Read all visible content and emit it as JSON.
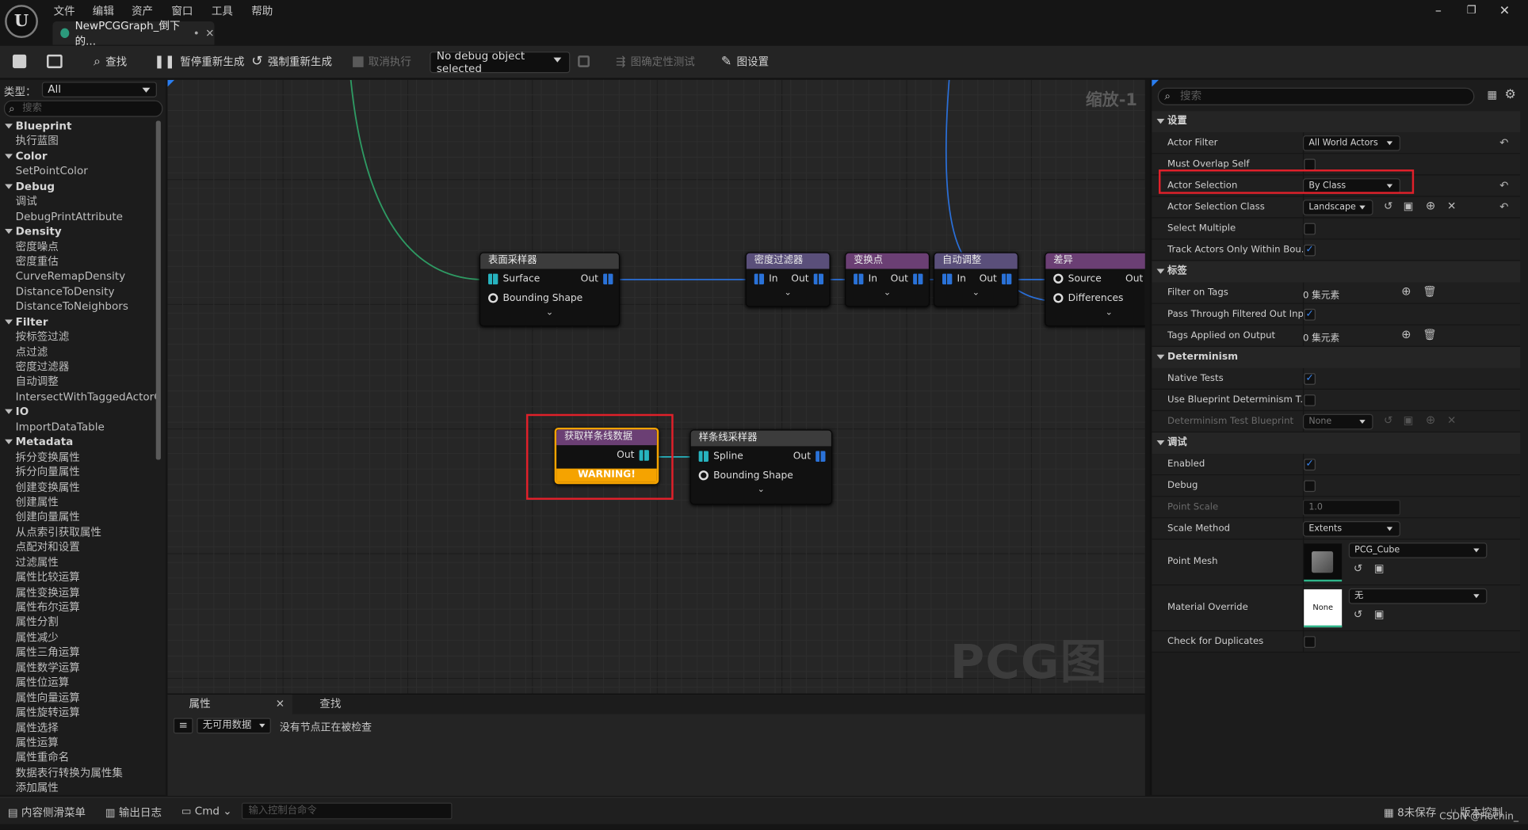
{
  "menu": [
    "文件",
    "编辑",
    "资产",
    "窗口",
    "工具",
    "帮助"
  ],
  "tab": {
    "title": "NewPCGGraph_倒下的..."
  },
  "toolbar": {
    "find": "查找",
    "pause": "暂停重新生成",
    "force": "强制重新生成",
    "cancel": "取消执行",
    "debug": "No debug object selected",
    "determinism": "图确定性测试",
    "settings": "图设置"
  },
  "palette": {
    "type_label": "类型：",
    "type_value": "All",
    "search_placeholder": "搜索",
    "items": [
      {
        "k": "cat",
        "t": "Blueprint"
      },
      {
        "k": "it",
        "t": "执行蓝图"
      },
      {
        "k": "cat",
        "t": "Color"
      },
      {
        "k": "it",
        "t": "SetPointColor"
      },
      {
        "k": "cat",
        "t": "Debug"
      },
      {
        "k": "it",
        "t": "调试"
      },
      {
        "k": "it",
        "t": "DebugPrintAttribute"
      },
      {
        "k": "cat",
        "t": "Density"
      },
      {
        "k": "it",
        "t": "密度噪点"
      },
      {
        "k": "it",
        "t": "密度重估"
      },
      {
        "k": "it",
        "t": "CurveRemapDensity"
      },
      {
        "k": "it",
        "t": "DistanceToDensity"
      },
      {
        "k": "it",
        "t": "DistanceToNeighbors"
      },
      {
        "k": "cat",
        "t": "Filter"
      },
      {
        "k": "it",
        "t": "按标签过滤"
      },
      {
        "k": "it",
        "t": "点过滤"
      },
      {
        "k": "it",
        "t": "密度过滤器"
      },
      {
        "k": "it",
        "t": "自动调整"
      },
      {
        "k": "it",
        "t": "IntersectWithTaggedActorGec"
      },
      {
        "k": "cat",
        "t": "IO"
      },
      {
        "k": "it",
        "t": "ImportDataTable"
      },
      {
        "k": "cat",
        "t": "Metadata"
      },
      {
        "k": "it",
        "t": "拆分变换属性"
      },
      {
        "k": "it",
        "t": "拆分向量属性"
      },
      {
        "k": "it",
        "t": "创建变换属性"
      },
      {
        "k": "it",
        "t": "创建属性"
      },
      {
        "k": "it",
        "t": "创建向量属性"
      },
      {
        "k": "it",
        "t": "从点索引获取属性"
      },
      {
        "k": "it",
        "t": "点配对和设置"
      },
      {
        "k": "it",
        "t": "过滤属性"
      },
      {
        "k": "it",
        "t": "属性比较运算"
      },
      {
        "k": "it",
        "t": "属性变换运算"
      },
      {
        "k": "it",
        "t": "属性布尔运算"
      },
      {
        "k": "it",
        "t": "属性分割"
      },
      {
        "k": "it",
        "t": "属性减少"
      },
      {
        "k": "it",
        "t": "属性三角运算"
      },
      {
        "k": "it",
        "t": "属性数学运算"
      },
      {
        "k": "it",
        "t": "属性位运算"
      },
      {
        "k": "it",
        "t": "属性向量运算"
      },
      {
        "k": "it",
        "t": "属性旋转运算"
      },
      {
        "k": "it",
        "t": "属性选择"
      },
      {
        "k": "it",
        "t": "属性运算"
      },
      {
        "k": "it",
        "t": "属性重命名"
      },
      {
        "k": "it",
        "t": "数据表行转换为属性集"
      },
      {
        "k": "it",
        "t": "添加属性"
      }
    ]
  },
  "graph": {
    "zoom": "缩放-1",
    "watermark": "PCG图表",
    "nodes": {
      "surface": {
        "title": "表面采样器",
        "pin1": "Surface",
        "pin2": "Bounding Shape",
        "out": "Out"
      },
      "density": {
        "title": "密度过滤器",
        "in": "In",
        "out": "Out"
      },
      "transform": {
        "title": "变换点",
        "in": "In",
        "out": "Out"
      },
      "auto": {
        "title": "自动调整",
        "in": "In",
        "out": "Out"
      },
      "diff": {
        "title": "差异",
        "pin1": "Source",
        "pin2": "Differences",
        "out": "Out"
      },
      "getspline": {
        "title": "获取样条线数据",
        "out": "Out",
        "warning": "WARNING!"
      },
      "splinesampler": {
        "title": "样条线采样器",
        "pin1": "Spline",
        "pin2": "Bounding Shape",
        "out": "Out"
      }
    }
  },
  "bottom": {
    "tab1": "属性",
    "tab2": "查找",
    "filter": "无可用数据",
    "status": "没有节点正在被检查"
  },
  "status": {
    "content": "内容侧滑菜单",
    "log": "输出日志",
    "cmd": "Cmd",
    "cmd_placeholder": "输入控制台命令",
    "unsaved": "8未保存",
    "vc": "版本控制",
    "credit": "CSDN @Hochin_"
  },
  "details": {
    "search_placeholder": "搜索",
    "sec_settings": "设置",
    "actor_filter": {
      "label": "Actor Filter",
      "value": "All World Actors"
    },
    "must_overlap": {
      "label": "Must Overlap Self"
    },
    "actor_selection": {
      "label": "Actor Selection",
      "value": "By Class"
    },
    "actor_class": {
      "label": "Actor Selection Class",
      "value": "Landscape"
    },
    "select_multiple": {
      "label": "Select Multiple"
    },
    "track_actors": {
      "label": "Track Actors Only Within Bou..."
    },
    "sec_tags": "标签",
    "filter_tags": {
      "label": "Filter on Tags",
      "value": "0 集元素"
    },
    "pass_through": {
      "label": "Pass Through Filtered Out Inp..."
    },
    "tags_applied": {
      "label": "Tags Applied on Output",
      "value": "0 集元素"
    },
    "sec_determinism": "Determinism",
    "native_tests": {
      "label": "Native Tests"
    },
    "use_bp": {
      "label": "Use Blueprint Determinism T..."
    },
    "det_bp": {
      "label": "Determinism Test Blueprint",
      "value": "None"
    },
    "sec_debug": "调试",
    "enabled": {
      "label": "Enabled"
    },
    "debug": {
      "label": "Debug"
    },
    "point_scale": {
      "label": "Point Scale",
      "value": "1.0"
    },
    "scale_method": {
      "label": "Scale Method",
      "value": "Extents"
    },
    "point_mesh": {
      "label": "Point Mesh",
      "value": "PCG_Cube"
    },
    "material": {
      "label": "Material Override",
      "value": "无",
      "thumb": "None"
    },
    "check_dup": {
      "label": "Check for Duplicates"
    }
  }
}
